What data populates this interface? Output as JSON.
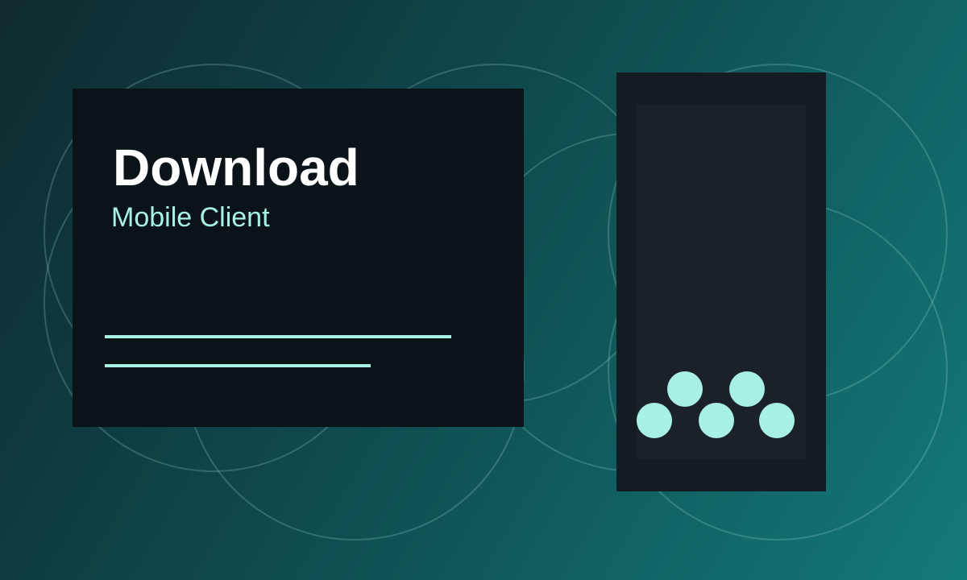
{
  "hero": {
    "title": "Download",
    "subtitle": "Mobile Client"
  },
  "colors": {
    "background_start": "#0f2a2e",
    "background_end": "#137a78",
    "card": "#0a1317",
    "phone": "#141b22",
    "phone_screen": "#1a2129",
    "accent": "#a8f0e6",
    "title_text": "#ffffff"
  },
  "phone": {
    "dots": 5
  }
}
